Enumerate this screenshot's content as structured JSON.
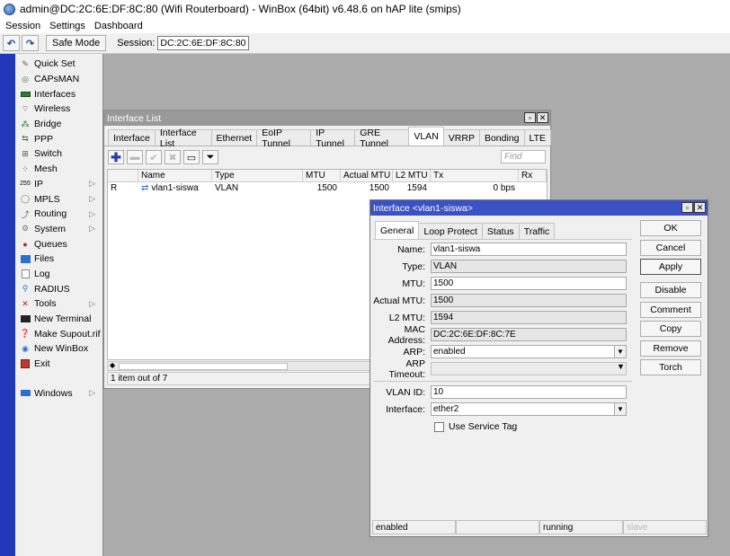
{
  "window": {
    "title": "admin@DC:2C:6E:DF:8C:80 (Wifi Routerboard) - WinBox (64bit) v6.48.6 on hAP lite (smips)"
  },
  "menu": [
    "Session",
    "Settings",
    "Dashboard"
  ],
  "toolbar": {
    "undo": "↶",
    "redo": "↷",
    "safe_mode": "Safe Mode",
    "session_label": "Session:",
    "session_value": "DC:2C:6E:DF:8C:80"
  },
  "sidebar": {
    "items": [
      {
        "label": "Quick Set",
        "icon": "wand-icon"
      },
      {
        "label": "CAPsMAN",
        "icon": "capsman-icon"
      },
      {
        "label": "Interfaces",
        "icon": "interfaces-icon"
      },
      {
        "label": "Wireless",
        "icon": "wireless-icon"
      },
      {
        "label": "Bridge",
        "icon": "bridge-icon"
      },
      {
        "label": "PPP",
        "icon": "ppp-icon"
      },
      {
        "label": "Switch",
        "icon": "switch-icon"
      },
      {
        "label": "Mesh",
        "icon": "mesh-icon"
      },
      {
        "label": "IP",
        "icon": "ip-icon",
        "submenu": true
      },
      {
        "label": "MPLS",
        "icon": "mpls-icon",
        "submenu": true
      },
      {
        "label": "Routing",
        "icon": "routing-icon",
        "submenu": true
      },
      {
        "label": "System",
        "icon": "system-icon",
        "submenu": true
      },
      {
        "label": "Queues",
        "icon": "queues-icon"
      },
      {
        "label": "Files",
        "icon": "files-icon"
      },
      {
        "label": "Log",
        "icon": "log-icon"
      },
      {
        "label": "RADIUS",
        "icon": "radius-icon"
      },
      {
        "label": "Tools",
        "icon": "tools-icon",
        "submenu": true
      },
      {
        "label": "New Terminal",
        "icon": "terminal-icon"
      },
      {
        "label": "Make Supout.rif",
        "icon": "supout-icon"
      },
      {
        "label": "New WinBox",
        "icon": "winbox-icon"
      },
      {
        "label": "Exit",
        "icon": "exit-icon"
      }
    ],
    "windows_label": "Windows"
  },
  "interface_list": {
    "title": "Interface List",
    "tabs": [
      "Interface",
      "Interface List",
      "Ethernet",
      "EoIP Tunnel",
      "IP Tunnel",
      "GRE Tunnel",
      "VLAN",
      "VRRP",
      "Bonding",
      "LTE"
    ],
    "active_tab": "VLAN",
    "find_placeholder": "Find",
    "columns": [
      "",
      "Name",
      "Type",
      "MTU",
      "Actual MTU",
      "L2 MTU",
      "Tx",
      "Rx"
    ],
    "rows": [
      {
        "flag": "R",
        "name": "vlan1-siswa",
        "type": "VLAN",
        "mtu": "1500",
        "actual_mtu": "1500",
        "l2_mtu": "1594",
        "tx": "0 bps",
        "rx": ""
      }
    ],
    "status": "1 item out of 7"
  },
  "interface_detail": {
    "title": "Interface <vlan1-siswa>",
    "tabs": [
      "General",
      "Loop Protect",
      "Status",
      "Traffic"
    ],
    "active_tab": "General",
    "fields": {
      "name_label": "Name:",
      "name": "vlan1-siswa",
      "type_label": "Type:",
      "type": "VLAN",
      "mtu_label": "MTU:",
      "mtu": "1500",
      "actual_mtu_label": "Actual MTU:",
      "actual_mtu": "1500",
      "l2_mtu_label": "L2 MTU:",
      "l2_mtu": "1594",
      "mac_label": "MAC Address:",
      "mac": "DC:2C:6E:DF:8C:7E",
      "arp_label": "ARP:",
      "arp": "enabled",
      "arp_timeout_label": "ARP Timeout:",
      "arp_timeout": "",
      "vlan_id_label": "VLAN ID:",
      "vlan_id": "10",
      "interface_label": "Interface:",
      "interface": "ether2",
      "service_tag_label": "Use Service Tag"
    },
    "buttons": [
      "OK",
      "Cancel",
      "Apply",
      "Disable",
      "Comment",
      "Copy",
      "Remove",
      "Torch"
    ],
    "status": {
      "enabled": "enabled",
      "running": "running",
      "slave": "slave"
    }
  }
}
